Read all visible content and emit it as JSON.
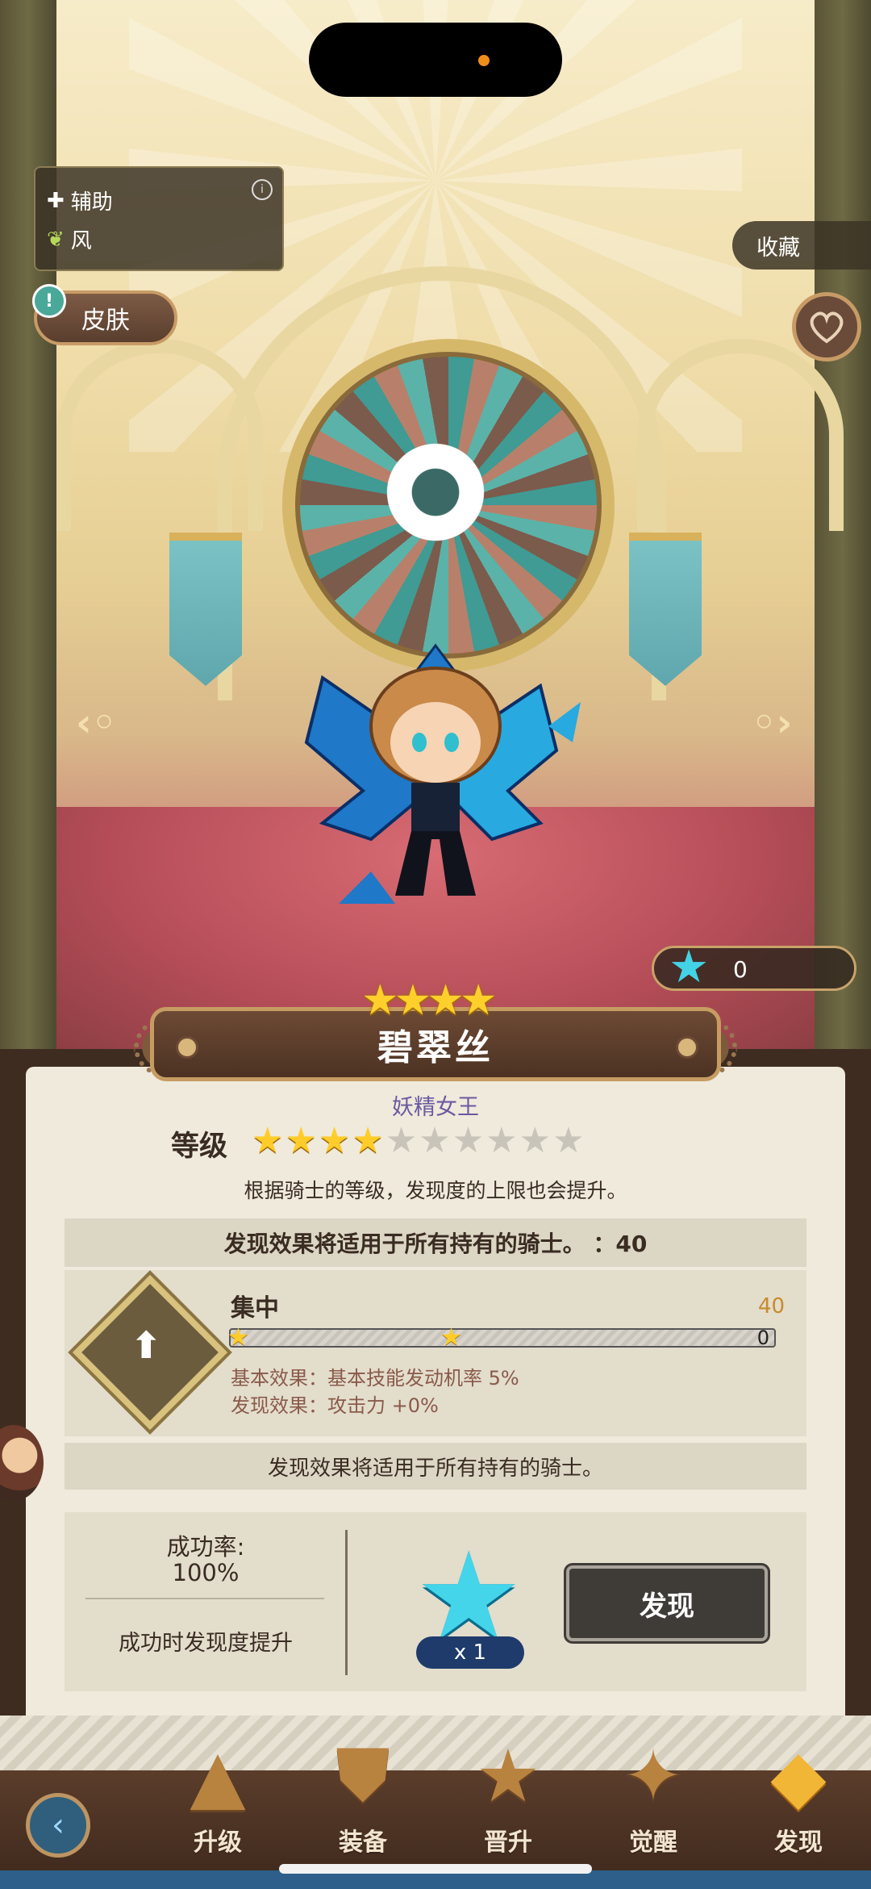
{
  "hero": {
    "role": "辅助",
    "element": "风",
    "name": "碧翠丝",
    "title": "妖精女王",
    "grade_stars": 4,
    "level_stars_on": 4,
    "level_stars_total": 10
  },
  "buttons": {
    "skin": "皮肤",
    "collect": "收藏"
  },
  "star_currency": "0",
  "level": {
    "label": "等级",
    "hint": "根据骑士的等级，发现度的上限也会提升。"
  },
  "effect_header": "发现效果将适用于所有持有的骑士。 ：40",
  "skill": {
    "name": "集中",
    "max_value": "40",
    "current_value": "0",
    "progress": 0,
    "base_effect": "基本效果：基本技能发动机率 5%",
    "discover_effect": "发现效果：攻击力 +0%"
  },
  "note": "发现效果将适用于所有持有的骑士。",
  "discover": {
    "rate_label": "成功率:",
    "rate_value": "100%",
    "rate_note": "成功时发现度提升",
    "cost_multiplier": "x 1",
    "button": "发现"
  },
  "tabs": [
    {
      "label": "升级",
      "icon": "upgrade-icon",
      "active": false
    },
    {
      "label": "装备",
      "icon": "equip-shield-icon",
      "active": false
    },
    {
      "label": "晋升",
      "icon": "promote-star-icon",
      "active": false
    },
    {
      "label": "觉醒",
      "icon": "awaken-icon",
      "active": false
    },
    {
      "label": "发现",
      "icon": "discover-icon",
      "active": true
    }
  ],
  "colors": {
    "accent_gold": "#ffcc2a",
    "star_cyan": "#44d5ea",
    "panel_brown": "#3f2c20",
    "card_bg": "#efeadc"
  }
}
